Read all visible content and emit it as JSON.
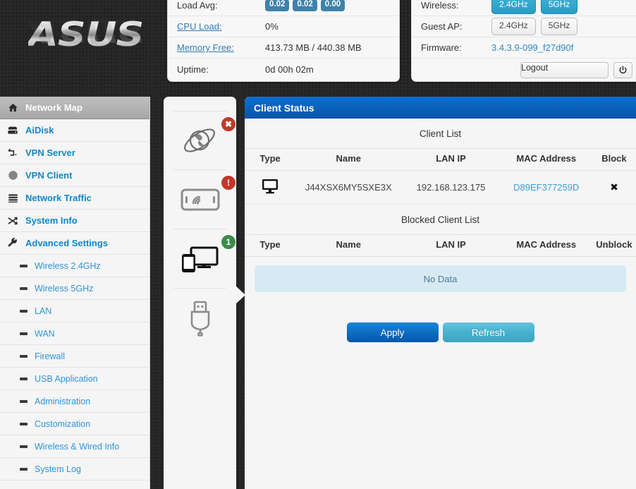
{
  "brand": {
    "logo_text": "ASUS"
  },
  "status_left": {
    "rows": [
      {
        "label": "Load Avg:",
        "type": "badges",
        "values": [
          "0.02",
          "0.02",
          "0.00"
        ],
        "link": false
      },
      {
        "label": "CPU Load:",
        "type": "text",
        "value": "0%",
        "link": true
      },
      {
        "label": "Memory Free:",
        "type": "text",
        "value": "413.73 MB / 440.38 MB",
        "link": true
      },
      {
        "label": "Uptime:",
        "type": "text",
        "value": "0d 00h 02m",
        "link": false
      }
    ]
  },
  "status_right": {
    "wireless_label": "Wireless:",
    "wireless_bands": [
      {
        "label": "2.4GHz",
        "active": true
      },
      {
        "label": "5GHz",
        "active": true
      }
    ],
    "guest_label": "Guest AP:",
    "guest_bands": [
      {
        "label": "2.4GHz",
        "active": false
      },
      {
        "label": "5GHz",
        "active": false
      }
    ],
    "firmware_label": "Firmware:",
    "firmware_value": "3.4.3.9-099_f27d90f",
    "logout_label": "Logout",
    "power_icon": "power-icon"
  },
  "sidebar": {
    "items": [
      {
        "label": "Network Map",
        "icon": "home-icon",
        "active": true
      },
      {
        "label": "AiDisk",
        "icon": "disk-icon",
        "active": false
      },
      {
        "label": "VPN Server",
        "icon": "vpn-server-icon",
        "active": false
      },
      {
        "label": "VPN Client",
        "icon": "globe-icon",
        "active": false
      },
      {
        "label": "Network Traffic",
        "icon": "list-icon",
        "active": false
      },
      {
        "label": "System Info",
        "icon": "shuffle-icon",
        "active": false
      },
      {
        "label": "Advanced Settings",
        "icon": "wrench-icon",
        "active": false
      }
    ],
    "sub_items": [
      {
        "label": "Wireless 2.4GHz"
      },
      {
        "label": "Wireless 5GHz"
      },
      {
        "label": "LAN"
      },
      {
        "label": "WAN"
      },
      {
        "label": "Firewall"
      },
      {
        "label": "USB Application"
      },
      {
        "label": "Administration"
      },
      {
        "label": "Customization"
      },
      {
        "label": "Wireless & Wired Info"
      },
      {
        "label": "System Log"
      }
    ]
  },
  "device_column": {
    "slots": [
      {
        "name": "internet-status",
        "icon": "globe-orbit-icon",
        "badge": "✖",
        "badge_kind": "err"
      },
      {
        "name": "router-status",
        "icon": "wireless-router-icon",
        "badge": "!",
        "badge_kind": "warn"
      },
      {
        "name": "clients-status",
        "icon": "clients-icon",
        "badge": "1",
        "badge_kind": "ok",
        "selected": true
      },
      {
        "name": "usb-status",
        "icon": "usb-icon",
        "badge": null,
        "badge_kind": null
      }
    ]
  },
  "main": {
    "panel_title": "Client Status",
    "client_list": {
      "title": "Client List",
      "columns": [
        "Type",
        "Name",
        "LAN IP",
        "MAC Address",
        "Block"
      ],
      "rows": [
        {
          "type_icon": "desktop-icon",
          "name": "J44XSX6MY5SXE3X",
          "lan_ip": "192.168.123.175",
          "mac": "D89EF377259D",
          "action": "✖"
        }
      ]
    },
    "blocked_list": {
      "title": "Blocked Client List",
      "columns": [
        "Type",
        "Name",
        "LAN IP",
        "MAC Address",
        "Unblock"
      ],
      "empty_text": "No Data"
    },
    "apply_label": "Apply",
    "refresh_label": "Refresh"
  },
  "colors": {
    "accent_blue": "#0b63bd",
    "link_blue": "#2f93d8",
    "badge_blue": "#3f82a8",
    "band_on": "#2a9cc3",
    "ok_green": "#3d8b4a",
    "err_red": "#c0392b",
    "nodata_bg": "#d7eaf4"
  }
}
